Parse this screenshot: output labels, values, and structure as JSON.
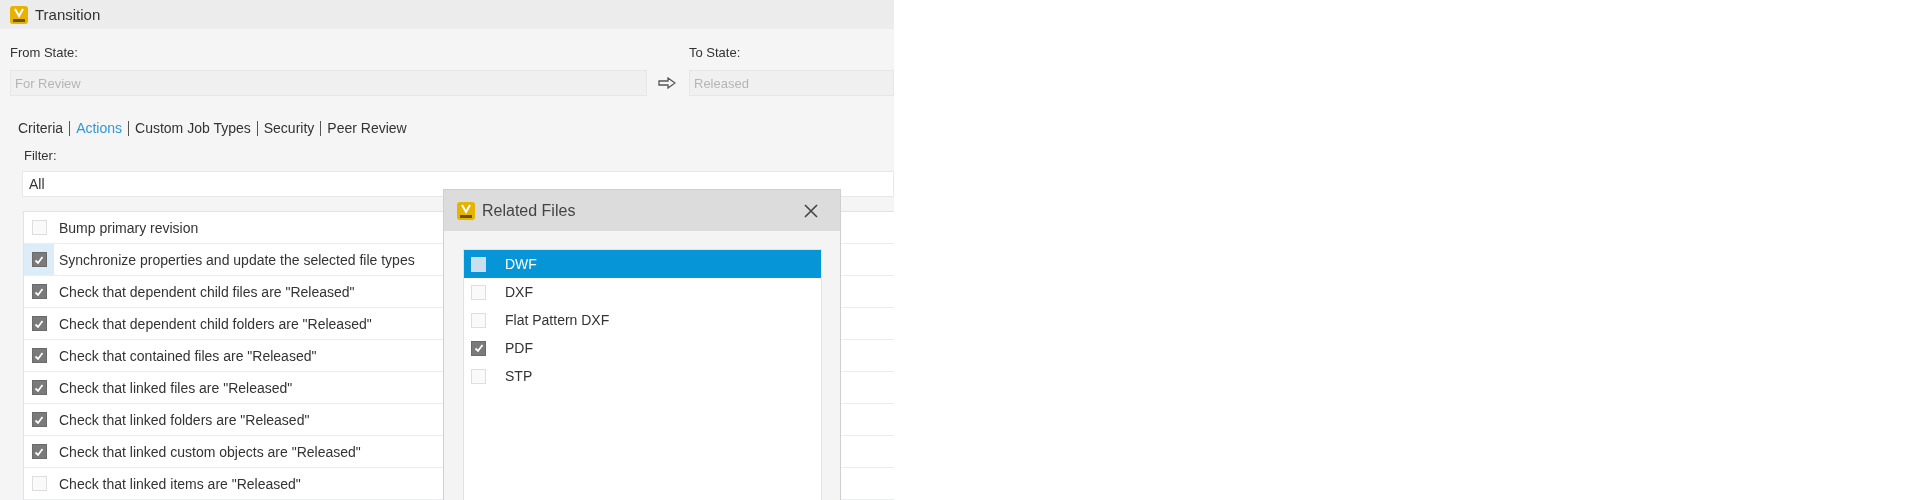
{
  "window": {
    "title": "Transition"
  },
  "from_state": {
    "label": "From State:",
    "value": "For Review",
    "disabled": true
  },
  "to_state": {
    "label": "To State:",
    "value": "Released",
    "disabled": true
  },
  "tabs": [
    {
      "label": "Criteria",
      "selected": false
    },
    {
      "label": "Actions",
      "selected": true
    },
    {
      "label": "Custom Job Types",
      "selected": false
    },
    {
      "label": "Security",
      "selected": false
    },
    {
      "label": "Peer Review",
      "selected": false
    }
  ],
  "filter": {
    "label": "Filter:",
    "value": "All"
  },
  "actions": [
    {
      "label": "Bump primary revision",
      "checked": false,
      "selected": false
    },
    {
      "label": "Synchronize properties and update the selected file types",
      "checked": true,
      "selected": true
    },
    {
      "label": "Check that dependent child files are \"Released\"",
      "checked": true,
      "selected": false
    },
    {
      "label": "Check that dependent child folders are \"Released\"",
      "checked": true,
      "selected": false
    },
    {
      "label": "Check that contained files are \"Released\"",
      "checked": true,
      "selected": false
    },
    {
      "label": "Check that linked files are \"Released\"",
      "checked": true,
      "selected": false
    },
    {
      "label": "Check that linked folders are \"Released\"",
      "checked": true,
      "selected": false
    },
    {
      "label": "Check that linked custom objects are \"Released\"",
      "checked": true,
      "selected": false
    },
    {
      "label": "Check that linked items are \"Released\"",
      "checked": false,
      "selected": false
    }
  ],
  "dialog": {
    "title": "Related Files",
    "items": [
      {
        "label": "DWF",
        "checked": false,
        "selected": true
      },
      {
        "label": "DXF",
        "checked": false,
        "selected": false
      },
      {
        "label": "Flat Pattern DXF",
        "checked": false,
        "selected": false
      },
      {
        "label": "PDF",
        "checked": true,
        "selected": false
      },
      {
        "label": "STP",
        "checked": false,
        "selected": false
      }
    ]
  }
}
